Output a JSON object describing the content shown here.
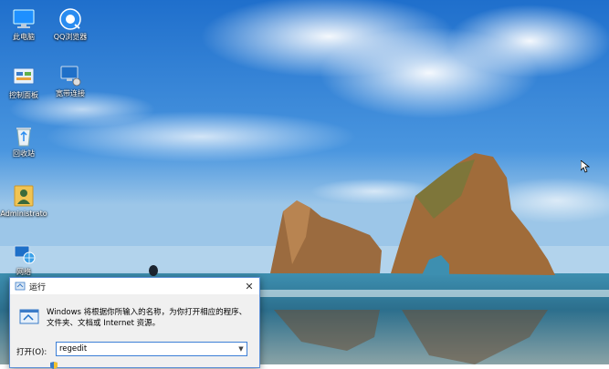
{
  "desktop": {
    "icons": [
      {
        "label": "此电脑",
        "icon": "this-pc-icon"
      },
      {
        "label": "QQ浏览器",
        "icon": "qq-browser-icon"
      },
      {
        "label": "控制面板",
        "icon": "control-panel-icon"
      },
      {
        "label": "宽带连接",
        "icon": "broadband-connection-icon"
      },
      {
        "label": "回收站",
        "icon": "recycle-bin-icon"
      },
      {
        "label": "Administrato",
        "icon": "user-folder-icon"
      },
      {
        "label": "网络",
        "icon": "network-icon"
      }
    ]
  },
  "run_dialog": {
    "title": "运行",
    "close_label": "✕",
    "description": "Windows 将根据你所输入的名称，为你打开相应的程序、文件夹、文档或 Internet 资源。",
    "open_label": "打开(O):",
    "open_value": "regedit"
  },
  "colors": {
    "accent": "#3c7fd6",
    "sky": "#2f7fd3",
    "sea": "#2a6f8a"
  }
}
